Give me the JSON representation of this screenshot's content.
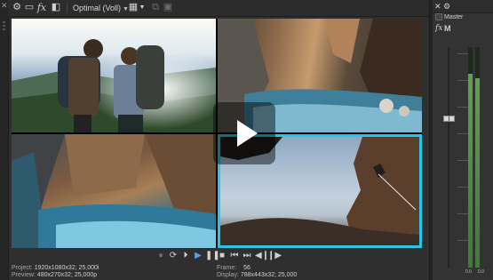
{
  "toolbar": {
    "close_icon": "close-icon",
    "icons": [
      "settings-icon",
      "device-icon",
      "fx-icon",
      "split-screen-icon"
    ],
    "fx_label": "fx",
    "quality_label": "Optimal (Voll)",
    "right_icons": [
      "overlays-icon",
      "copy-snapshot-icon",
      "save-snapshot-icon"
    ]
  },
  "preview": {
    "clips": [
      "hikers-clip",
      "canyon-river-clip",
      "slot-canyon-clip",
      "rock-climber-clip"
    ],
    "selected_clip": "rock-climber-clip",
    "accent_color": "#26c6e6"
  },
  "transport": {
    "buttons": [
      "record-button",
      "loop-button",
      "play-from-start-button",
      "play-button",
      "pause-button",
      "stop-button",
      "prev-frame-button",
      "next-frame-button",
      "go-to-start-button",
      "go-to-end-button"
    ]
  },
  "status": {
    "project_label": "Project:",
    "project_value": "1920x1080x32; 25,000i",
    "preview_label": "Preview:",
    "preview_value": "480x270x32; 25,000p",
    "frame_label": "Frame:",
    "frame_value": "56",
    "display_label": "Display:",
    "display_value": "788x443x32; 25,000"
  },
  "master": {
    "close_icon": "close-icon",
    "settings_icon": "settings-icon",
    "title": "Master",
    "fx_label": "fx",
    "m_label": "M",
    "left_level": "0.0",
    "right_level": "0.0",
    "meter_color": "#5fa24f"
  }
}
